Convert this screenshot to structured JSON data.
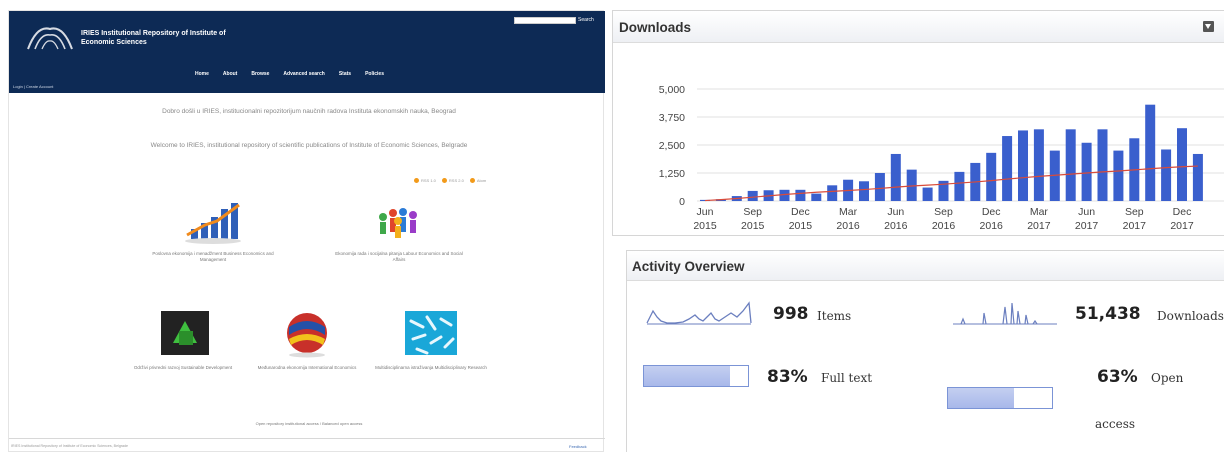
{
  "repository": {
    "site_title": "IRIES Institutional Repository of Institute of Economic Sciences",
    "search_button": "Search",
    "nav": [
      "Home",
      "About",
      "Browse",
      "Advanced search",
      "Stats",
      "Policies"
    ],
    "login": "Login | Create Account",
    "intro_sr": "Dobro došli u IRIES, institucionalni repozitorijum naučnih radova Instituta ekonomskih nauka, Beograd",
    "intro_en": "Welcome to IRIES, institutional repository of scientific publications of Institute of Economic Sciences, Belgrade",
    "feeds": [
      "RSS 1.0",
      "RSS 2.0",
      "Atom"
    ],
    "communities": [
      {
        "caption": "Poslovna ekonomija i menadžment Business Economics and Management"
      },
      {
        "caption": "Ekonomija rada i socijalna pitanja Labour Economics and Social Affairs"
      },
      {
        "caption": "Održivi privredni razvoj Sustainable Development"
      },
      {
        "caption": "Međunarodna ekonomija International Economics"
      },
      {
        "caption": "Multidisciplinarna istraživanja Multidisciplinary Research"
      }
    ],
    "footer_note": "Open repository institutional access / Balanced open access",
    "footer_text": "IRIES Institutional Repository of Institute of Economic Sciences, Belgrade",
    "footer_link": "Feedback"
  },
  "downloads": {
    "title": "Downloads",
    "collapse_icon": "collapse-arrow-icon"
  },
  "chart_data": {
    "type": "bar",
    "title": "Downloads",
    "ylim": [
      0,
      5000
    ],
    "yticks": [
      "5,000",
      "3,750",
      "2,500",
      "1,250",
      "0"
    ],
    "xticks": [
      {
        "m": "Jun",
        "y": "2015"
      },
      {
        "m": "Sep",
        "y": "2015"
      },
      {
        "m": "Dec",
        "y": "2015"
      },
      {
        "m": "Mar",
        "y": "2016"
      },
      {
        "m": "Jun",
        "y": "2016"
      },
      {
        "m": "Sep",
        "y": "2016"
      },
      {
        "m": "Dec",
        "y": "2016"
      },
      {
        "m": "Mar",
        "y": "2017"
      },
      {
        "m": "Jun",
        "y": "2017"
      },
      {
        "m": "Sep",
        "y": "2017"
      },
      {
        "m": "Dec",
        "y": "2017"
      }
    ],
    "categories": [
      "Jun 2015",
      "Jul 2015",
      "Aug 2015",
      "Sep 2015",
      "Oct 2015",
      "Nov 2015",
      "Dec 2015",
      "Jan 2016",
      "Feb 2016",
      "Mar 2016",
      "Apr 2016",
      "May 2016",
      "Jun 2016",
      "Jul 2016",
      "Aug 2016",
      "Sep 2016",
      "Oct 2016",
      "Nov 2016",
      "Dec 2016",
      "Jan 2017",
      "Feb 2017",
      "Mar 2017",
      "Apr 2017",
      "May 2017",
      "Jun 2017",
      "Jul 2017",
      "Aug 2017",
      "Sep 2017",
      "Oct 2017",
      "Nov 2017",
      "Dec 2017",
      "Jan 2018"
    ],
    "values": [
      50,
      80,
      220,
      450,
      480,
      500,
      500,
      330,
      700,
      950,
      880,
      1250,
      2100,
      1400,
      600,
      900,
      1300,
      1700,
      2150,
      2900,
      3150,
      3200,
      2250,
      3200,
      2600,
      3200,
      2250,
      2800,
      4300,
      2300,
      3250,
      2100
    ],
    "trend": [
      20,
      60,
      110,
      170,
      230,
      290,
      340,
      390,
      430,
      470,
      510,
      560,
      620,
      670,
      710,
      750,
      800,
      850,
      910,
      980,
      1040,
      1100,
      1150,
      1200,
      1250,
      1300,
      1340,
      1390,
      1440,
      1490,
      1530,
      1560
    ],
    "colors": {
      "bar": "#3a5fcd",
      "trend": "#d94b3a",
      "grid": "#e2e2e2"
    }
  },
  "activity": {
    "title": "Activity Overview",
    "items": {
      "value": "998",
      "label": "Items"
    },
    "downloads": {
      "value": "51,438",
      "label": "Downloads"
    },
    "fulltext": {
      "value": "83%",
      "label": "Full text",
      "fraction": 0.83
    },
    "openaccess": {
      "value": "63%",
      "label": "Open",
      "label2": "access",
      "fraction": 0.63
    },
    "colors": {
      "spark": "#6b7fbf",
      "bar": "#a8b8ea"
    }
  }
}
